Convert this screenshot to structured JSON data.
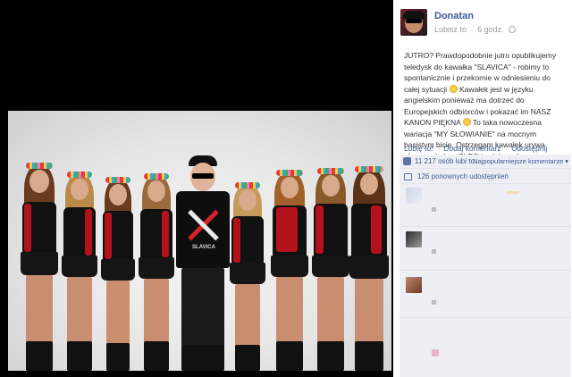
{
  "post": {
    "author": "Donatan",
    "like_link": "Lubisz to",
    "separator": "·",
    "time": "6 godz.",
    "body": "JUTRO? Prawdopodobnie jutro opublikujemy teledysk do kawałka \"SLAVICA\" - robimy to spontanicznie i przekornie w odniesieniu do całej sytuacji",
    "body2": "Kawałek jest w języku angielskim ponieważ ma dotrzeć do Europejskich odbiorców i pokazać im NASZ KANON PIĘKNA",
    "body3": "To taka nowoczesna wariacja \"MY SŁOWIANIE\" na mocnym basistym bicie. Ostrzegam kawałek urywa głowę wokalem CLEO i ocieka seksem. Gotowi?"
  },
  "actions": {
    "like": "Lubię to!",
    "comment": "Dodaj komentarz",
    "share": "Udostępnij"
  },
  "ufi": {
    "likes": "11 217 osób lubi to.",
    "sort": "Najpopularniejsze komentarze ▾",
    "shares": "126 ponownych udostępnień"
  },
  "photo": {
    "shirt_text": "SLAVICA"
  },
  "colors": {
    "link": "#3b5998",
    "panel_bg": "#edeff4",
    "vest_red": "#b3121a"
  }
}
